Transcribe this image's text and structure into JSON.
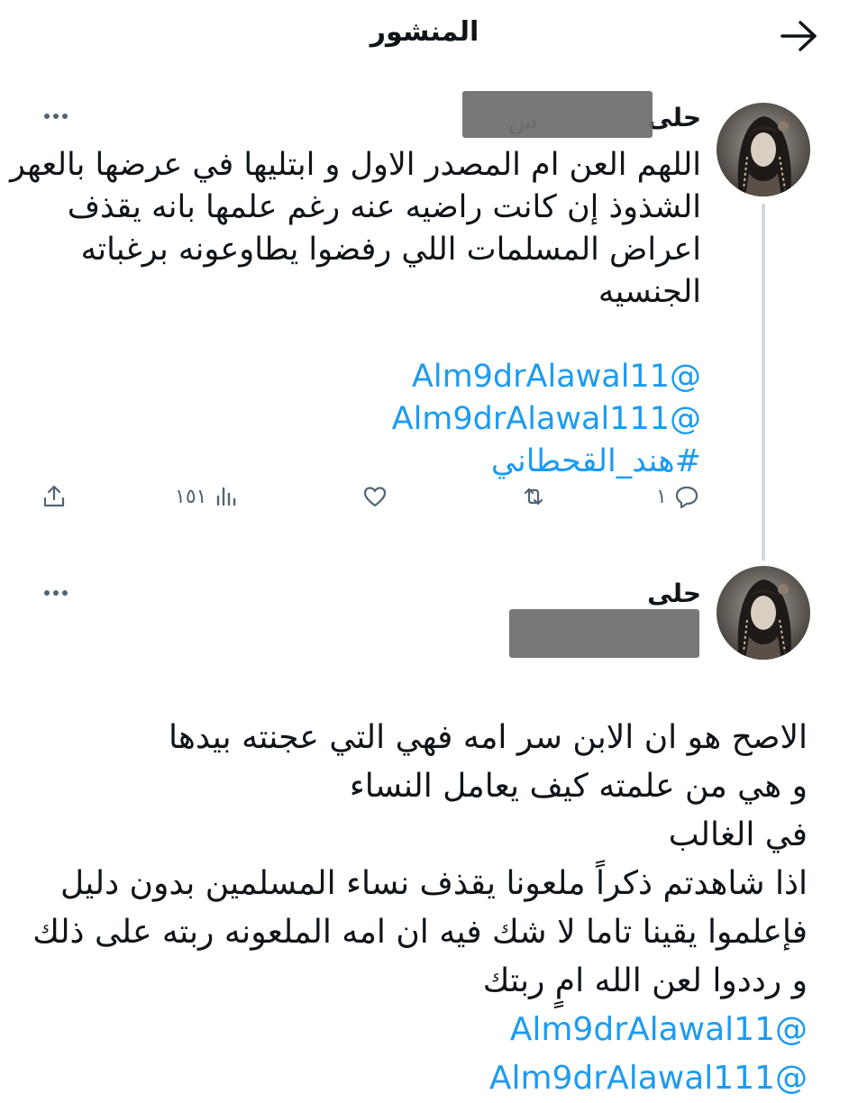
{
  "header": {
    "title": "المنشور"
  },
  "tweet1": {
    "author_name": "حلى",
    "handle_suffix": "س",
    "text_lines": [
      "اللهم العن ام المصدر الاول و ابتليها في عرضها بالعهر و",
      "الشذوذ إن كانت راضيه عنه رغم علمها بانه يقذف",
      "اعراض المسلمات اللي رفضوا يطاوعونه برغباته",
      "الجنسيه"
    ],
    "links": [
      "@Alm9drAlawal11",
      "@Alm9drAlawal111",
      "#هند_القحطاني"
    ],
    "actions": {
      "replies": "١",
      "retweets": "",
      "likes": "",
      "views": "١٥١"
    }
  },
  "tweet2": {
    "author_name": "حلى",
    "text_lines": [
      "الاصح هو ان الابن سر امه فهي التي عجنته بيدها",
      "و هي من علمته كيف يعامل النساء",
      "في الغالب",
      "اذا شاهدتم ذكراً ملعونا يقذف نساء المسلمين بدون دليل",
      "فإعلموا يقينا تاما لا شك فيه ان امه الملعونه ربته على ذلك",
      "و رددوا لعن الله امٍ ربتك"
    ],
    "links": [
      "@Alm9drAlawal11",
      "@Alm9drAlawal111"
    ]
  },
  "icons": [
    "back-arrow-icon",
    "more-icon",
    "reply-icon",
    "retweet-icon",
    "like-icon",
    "views-icon",
    "share-icon"
  ],
  "colors": {
    "link": "#1d9bf0",
    "secondary": "#536471",
    "text": "#0f1419",
    "thread_line": "#cfd9de"
  }
}
